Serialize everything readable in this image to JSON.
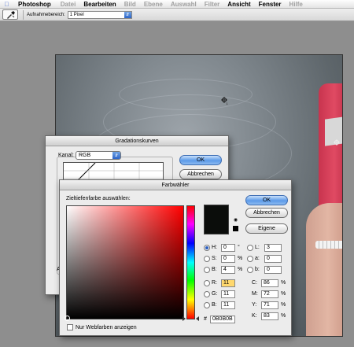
{
  "menubar": {
    "app_name": "Photoshop",
    "items": [
      {
        "label": "Datei",
        "enabled": false
      },
      {
        "label": "Bearbeiten",
        "enabled": true
      },
      {
        "label": "Bild",
        "enabled": false
      },
      {
        "label": "Ebene",
        "enabled": false
      },
      {
        "label": "Auswahl",
        "enabled": false
      },
      {
        "label": "Filter",
        "enabled": false
      },
      {
        "label": "Ansicht",
        "enabled": true
      },
      {
        "label": "Fenster",
        "enabled": true
      },
      {
        "label": "Hilfe",
        "enabled": false
      }
    ]
  },
  "options": {
    "sample_label": "Aufnahmebereich:",
    "sample_value": "1 Pixel"
  },
  "curves": {
    "title": "Gradationskurven",
    "channel_label": "Kanal:",
    "channel_value": "RGB",
    "ok": "OK",
    "cancel": "Abbrechen",
    "e_label": "E",
    "a_label": "A"
  },
  "picker": {
    "title": "Farbwähler",
    "prompt": "Zieltiefenfarbe auswählen:",
    "ok": "OK",
    "cancel": "Abbrechen",
    "custom": "Eigene",
    "hsb": [
      {
        "key": "H:",
        "value": "0",
        "unit": "°",
        "selected": true
      },
      {
        "key": "S:",
        "value": "0",
        "unit": "%",
        "selected": false
      },
      {
        "key": "B:",
        "value": "4",
        "unit": "%",
        "selected": false
      }
    ],
    "rgb": [
      {
        "key": "R:",
        "value": "11",
        "highlight": true
      },
      {
        "key": "G:",
        "value": "11",
        "highlight": false
      },
      {
        "key": "B:",
        "value": "11",
        "highlight": false
      }
    ],
    "lab": [
      {
        "key": "L:",
        "value": "3"
      },
      {
        "key": "a:",
        "value": "0"
      },
      {
        "key": "b:",
        "value": "0"
      }
    ],
    "cmyk": [
      {
        "key": "C:",
        "value": "86",
        "unit": "%"
      },
      {
        "key": "M:",
        "value": "72",
        "unit": "%"
      },
      {
        "key": "Y:",
        "value": "71",
        "unit": "%"
      },
      {
        "key": "K:",
        "value": "83",
        "unit": "%"
      }
    ],
    "hex_label": "#",
    "hex_value": "0B0B0B",
    "web_colors_label": "Nur Webfarben anzeigen",
    "selected_color": "#0b0d0b"
  }
}
